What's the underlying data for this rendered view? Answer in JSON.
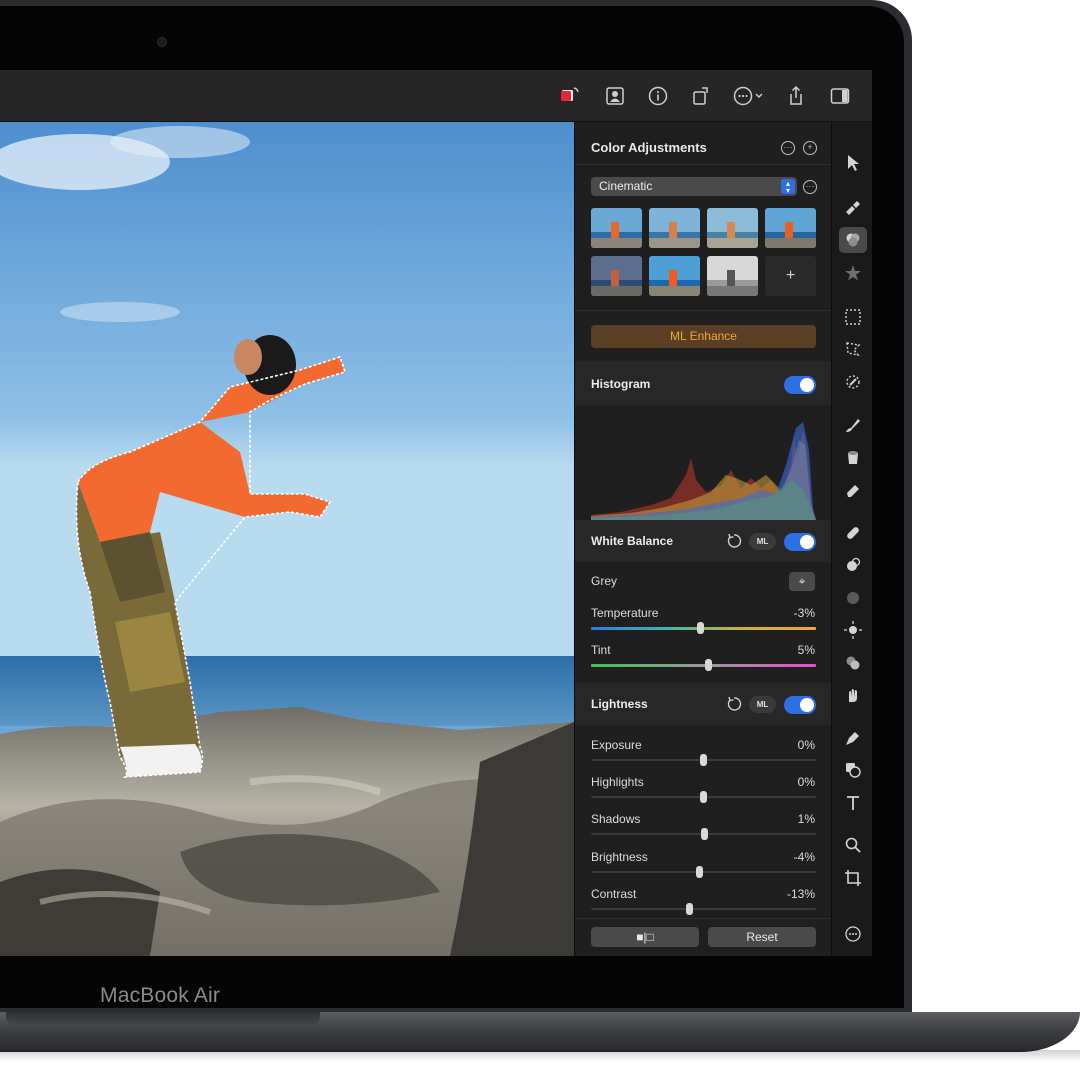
{
  "device": {
    "label": "MacBook Air"
  },
  "toolbar": {
    "icons": [
      "color-swap-icon",
      "person-mask-icon",
      "info-icon",
      "rotate-icon",
      "more-icon",
      "share-icon",
      "sidebar-icon"
    ]
  },
  "inspector": {
    "title": "Color Adjustments",
    "preset": {
      "selected": "Cinematic"
    },
    "ml_enhance_label": "ML Enhance",
    "add_thumb_label": "+",
    "histogram": {
      "title": "Histogram",
      "enabled": true
    },
    "white_balance": {
      "title": "White Balance",
      "ml_label": "ML",
      "enabled": true,
      "grey_label": "Grey",
      "temperature": {
        "label": "Temperature",
        "value": "-3%",
        "level": -3
      },
      "tint": {
        "label": "Tint",
        "value": "5%",
        "level": 5
      }
    },
    "lightness": {
      "title": "Lightness",
      "ml_label": "ML",
      "enabled": true,
      "rows": [
        {
          "label": "Exposure",
          "value": "0%",
          "level": 0
        },
        {
          "label": "Highlights",
          "value": "0%",
          "level": 0
        },
        {
          "label": "Shadows",
          "value": "1%",
          "level": 1
        },
        {
          "label": "Brightness",
          "value": "-4%",
          "level": -4
        },
        {
          "label": "Contrast",
          "value": "-13%",
          "level": -13
        }
      ]
    },
    "footer": {
      "compare_label": "■|□",
      "reset_label": "Reset"
    }
  },
  "tools": [
    "pointer-tool-icon",
    "paint-tool-icon",
    "color-adjust-tool-icon",
    "effects-tool-icon",
    "rect-select-tool-icon",
    "lasso-select-tool-icon",
    "smart-select-tool-icon",
    "brush-tool-icon",
    "fill-tool-icon",
    "eraser-tool-icon",
    "heal-tool-icon",
    "clone-tool-icon",
    "blur-tool-icon",
    "light-tool-icon",
    "shapes-color-tool-icon",
    "smudge-tool-icon",
    "pen-tool-icon",
    "shapes-tool-icon",
    "text-tool-icon",
    "zoom-tool-icon",
    "crop-tool-icon",
    "more-tools-icon"
  ]
}
